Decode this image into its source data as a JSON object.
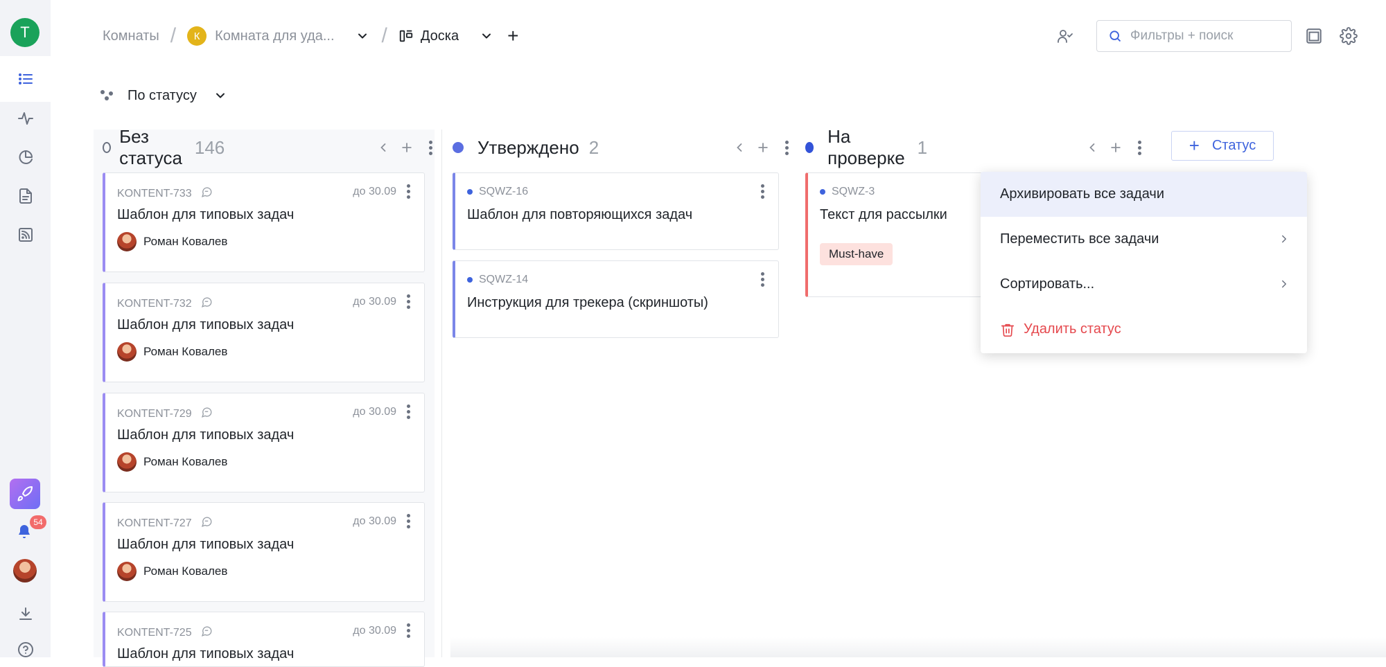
{
  "rail": {
    "user_initial": "T",
    "notifications_count": "54"
  },
  "breadcrumb": {
    "rooms": "Комнаты",
    "room_initial": "К",
    "room_name": "Комната для уда...",
    "board": "Доска"
  },
  "search": {
    "placeholder": "Фильтры + поиск"
  },
  "groupby": {
    "label": "По статусу"
  },
  "add_status": {
    "label": "Статус"
  },
  "columns": [
    {
      "name": "Без статуса",
      "count": "146",
      "cards": [
        {
          "id": "KONTENT-733",
          "due": "до 30.09",
          "title": "Шаблон для типовых задач",
          "assignee": "Роман Ковалев"
        },
        {
          "id": "KONTENT-732",
          "due": "до 30.09",
          "title": "Шаблон для типовых задач",
          "assignee": "Роман Ковалев"
        },
        {
          "id": "KONTENT-729",
          "due": "до 30.09",
          "title": "Шаблон для типовых задач",
          "assignee": "Роман Ковалев"
        },
        {
          "id": "KONTENT-727",
          "due": "до 30.09",
          "title": "Шаблон для типовых задач",
          "assignee": "Роман Ковалев"
        },
        {
          "id": "KONTENT-725",
          "due": "до 30.09",
          "title": "Шаблон для типовых задач",
          "assignee": ""
        }
      ]
    },
    {
      "name": "Утверждено",
      "count": "2",
      "color": "#5b6ee1",
      "cards": [
        {
          "id": "SQWZ-16",
          "title": "Шаблон для повторяющихся задач"
        },
        {
          "id": "SQWZ-14",
          "title": "Инструкция для трекера (скриншоты)"
        }
      ]
    },
    {
      "name": "На проверке",
      "count": "1",
      "color": "#3353d8",
      "cards": [
        {
          "id": "SQWZ-3",
          "title": "Текст для рассылки",
          "tag": "Must-have"
        }
      ]
    }
  ],
  "menu": {
    "archive_all": "Архивировать все задачи",
    "move_all": "Переместить все задачи",
    "sort": "Сортировать...",
    "delete_status": "Удалить статус"
  },
  "colors": {
    "accent": "#3e63dd",
    "danger": "#e5484d",
    "card_accent_purple": "#9b8cf2",
    "card_accent_blue": "#7b86e8",
    "card_accent_red": "#f06d6d"
  }
}
